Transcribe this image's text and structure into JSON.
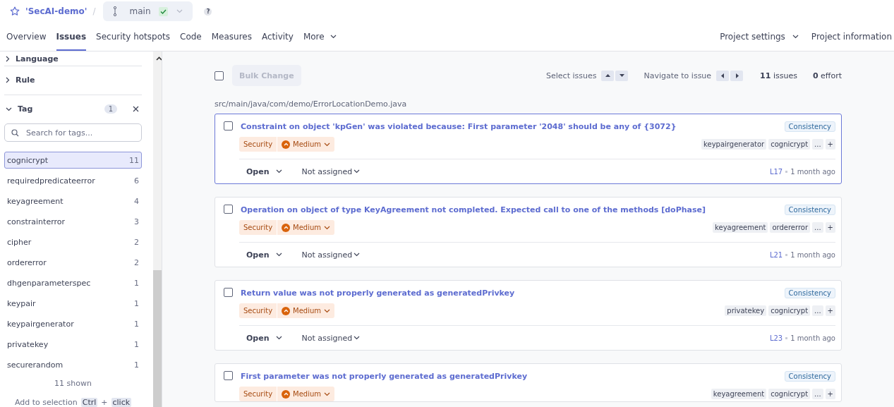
{
  "project": {
    "name": "'SecAI-demo'",
    "separator": "/",
    "branch": "main",
    "branch_ok": true,
    "help": "?"
  },
  "nav": {
    "tabs": [
      {
        "label": "Overview",
        "selected": false,
        "dropdown": false
      },
      {
        "label": "Issues",
        "selected": true,
        "dropdown": false
      },
      {
        "label": "Security hotspots",
        "selected": false,
        "dropdown": false
      },
      {
        "label": "Code",
        "selected": false,
        "dropdown": false
      },
      {
        "label": "Measures",
        "selected": false,
        "dropdown": false
      },
      {
        "label": "Activity",
        "selected": false,
        "dropdown": false
      },
      {
        "label": "More",
        "selected": false,
        "dropdown": true
      }
    ],
    "right": [
      {
        "label": "Project settings",
        "dropdown": true
      },
      {
        "label": "Project information",
        "dropdown": false
      }
    ]
  },
  "sidebar": {
    "facets": [
      {
        "label": "Language",
        "expanded": false
      },
      {
        "label": "Rule",
        "expanded": false
      }
    ],
    "tag_facet": {
      "label": "Tag",
      "expanded": true,
      "count": "1"
    },
    "search": {
      "placeholder": "Search for tags..."
    },
    "tags": [
      {
        "name": "cognicrypt",
        "count": "11",
        "selected": true
      },
      {
        "name": "requiredpredicateerror",
        "count": "6",
        "selected": false
      },
      {
        "name": "keyagreement",
        "count": "4",
        "selected": false
      },
      {
        "name": "constrainterror",
        "count": "3",
        "selected": false
      },
      {
        "name": "cipher",
        "count": "2",
        "selected": false
      },
      {
        "name": "ordererror",
        "count": "2",
        "selected": false
      },
      {
        "name": "dhgenparameterspec",
        "count": "1",
        "selected": false
      },
      {
        "name": "keypair",
        "count": "1",
        "selected": false
      },
      {
        "name": "keypairgenerator",
        "count": "1",
        "selected": false
      },
      {
        "name": "privatekey",
        "count": "1",
        "selected": false
      },
      {
        "name": "securerandom",
        "count": "1",
        "selected": false
      }
    ],
    "shown": "11 shown",
    "hint": {
      "text": "Add to selection",
      "keys": [
        "Ctrl",
        "click"
      ],
      "plus": "+"
    }
  },
  "toolbar": {
    "select_all_checked": false,
    "bulk_change": "Bulk Change",
    "bulk_disabled": true,
    "select_issues": "Select issues",
    "navigate": "Navigate to issue",
    "issues_total": "**11** issues",
    "effort": "**0** effort"
  },
  "file_path": "src/main/java/com/demo/ErrorLocationDemo.java",
  "issues": [
    {
      "title": "Constraint on object 'kpGen' was violated because: First parameter '2048' should be any of {3072}",
      "selected": true,
      "checked": false,
      "attribute": "Consistency",
      "quality": "Security",
      "severity": "Medium",
      "tags": [
        "keypairgenerator",
        "cognicrypt"
      ],
      "more": "...",
      "add": "+",
      "status": "Open",
      "assignee": "Not assigned",
      "line": "L17",
      "age": "1 month ago"
    },
    {
      "title": "Operation on object of type KeyAgreement not completed. Expected call to one of the methods [doPhase]",
      "selected": false,
      "checked": false,
      "attribute": "Consistency",
      "quality": "Security",
      "severity": "Medium",
      "tags": [
        "keyagreement",
        "ordererror"
      ],
      "more": "...",
      "add": "+",
      "status": "Open",
      "assignee": "Not assigned",
      "line": "L21",
      "age": "1 month ago"
    },
    {
      "title": "Return value was not properly generated as generatedPrivkey",
      "selected": false,
      "checked": false,
      "attribute": "Consistency",
      "quality": "Security",
      "severity": "Medium",
      "tags": [
        "privatekey",
        "cognicrypt"
      ],
      "more": "...",
      "add": "+",
      "status": "Open",
      "assignee": "Not assigned",
      "line": "L23",
      "age": "1 month ago"
    },
    {
      "title": "First parameter was not properly generated as generatedPrivkey",
      "selected": false,
      "checked": false,
      "attribute": "Consistency",
      "quality": "Security",
      "severity": "Medium",
      "tags": [
        "keyagreement",
        "cognicrypt"
      ],
      "more": "...",
      "add": "+"
    }
  ]
}
